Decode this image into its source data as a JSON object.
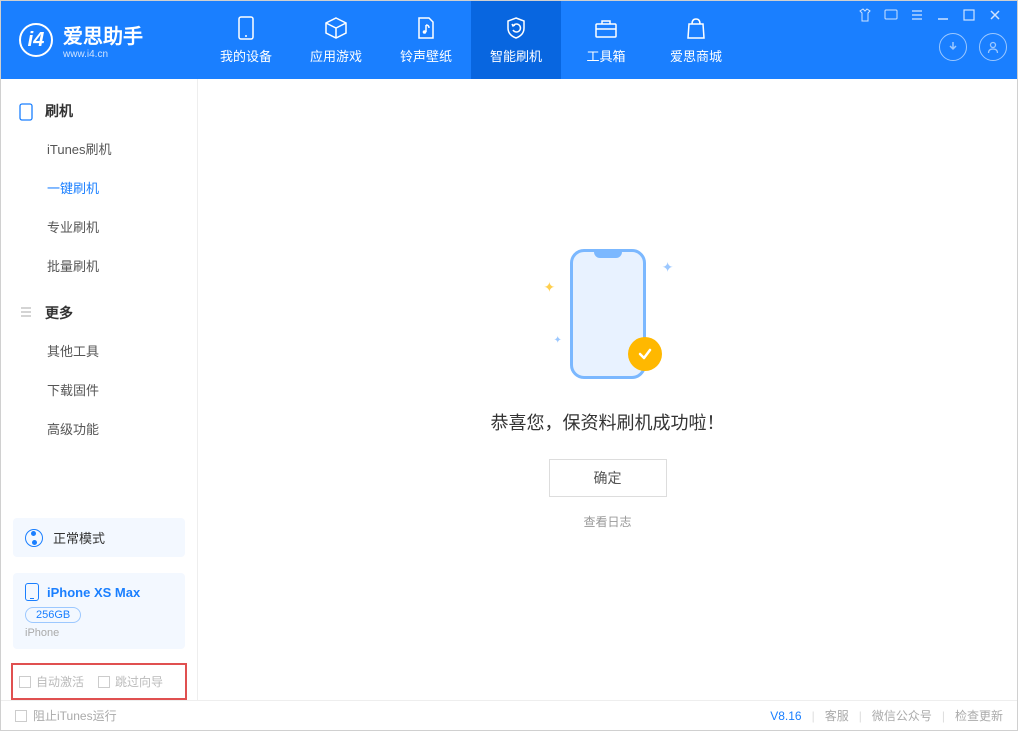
{
  "app": {
    "title": "爱思助手",
    "subtitle": "www.i4.cn"
  },
  "tabs": [
    {
      "label": "我的设备"
    },
    {
      "label": "应用游戏"
    },
    {
      "label": "铃声壁纸"
    },
    {
      "label": "智能刷机"
    },
    {
      "label": "工具箱"
    },
    {
      "label": "爱思商城"
    }
  ],
  "sidebar": {
    "section1": {
      "title": "刷机",
      "items": [
        "iTunes刷机",
        "一键刷机",
        "专业刷机",
        "批量刷机"
      ]
    },
    "section2": {
      "title": "更多",
      "items": [
        "其他工具",
        "下载固件",
        "高级功能"
      ]
    }
  },
  "mode": {
    "label": "正常模式"
  },
  "device": {
    "name": "iPhone XS Max",
    "storage": "256GB",
    "type": "iPhone"
  },
  "options": {
    "opt1": "自动激活",
    "opt2": "跳过向导"
  },
  "main": {
    "success": "恭喜您，保资料刷机成功啦！",
    "ok": "确定",
    "view_log": "查看日志"
  },
  "footer": {
    "stop_itunes": "阻止iTunes运行",
    "version": "V8.16",
    "links": [
      "客服",
      "微信公众号",
      "检查更新"
    ]
  }
}
